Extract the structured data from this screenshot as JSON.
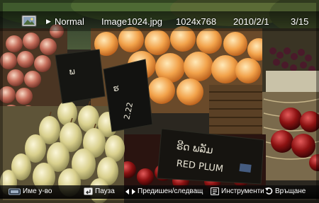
{
  "topbar": {
    "mode": "Normal",
    "filename": "Image1024.jpg",
    "resolution": "1024x768",
    "date": "2010/2/1",
    "counter": "3/15"
  },
  "photo": {
    "sign_left_1": "ພ",
    "sign_left_2": "ຮ",
    "sign_mid_number": "2.22",
    "sign_center_script": "ຣີດ ພລັມ",
    "sign_center_text": "RED PLUM"
  },
  "bottombar": {
    "device_name": "Име у-во",
    "pause": "Пауза",
    "prev_next": "Предишен/следващ",
    "tools": "Инструменти",
    "back": "Връщане"
  },
  "colors": {
    "bar_overlay": "#000000",
    "text": "#ffffff",
    "tools_icon": "#e0e0e0",
    "back_icon": "#ffffff"
  },
  "icons": [
    "photo-icon",
    "play-icon",
    "tv-remote-icon",
    "enter-pause-icon",
    "left-right-arrows-icon",
    "tools-icon",
    "return-icon"
  ]
}
